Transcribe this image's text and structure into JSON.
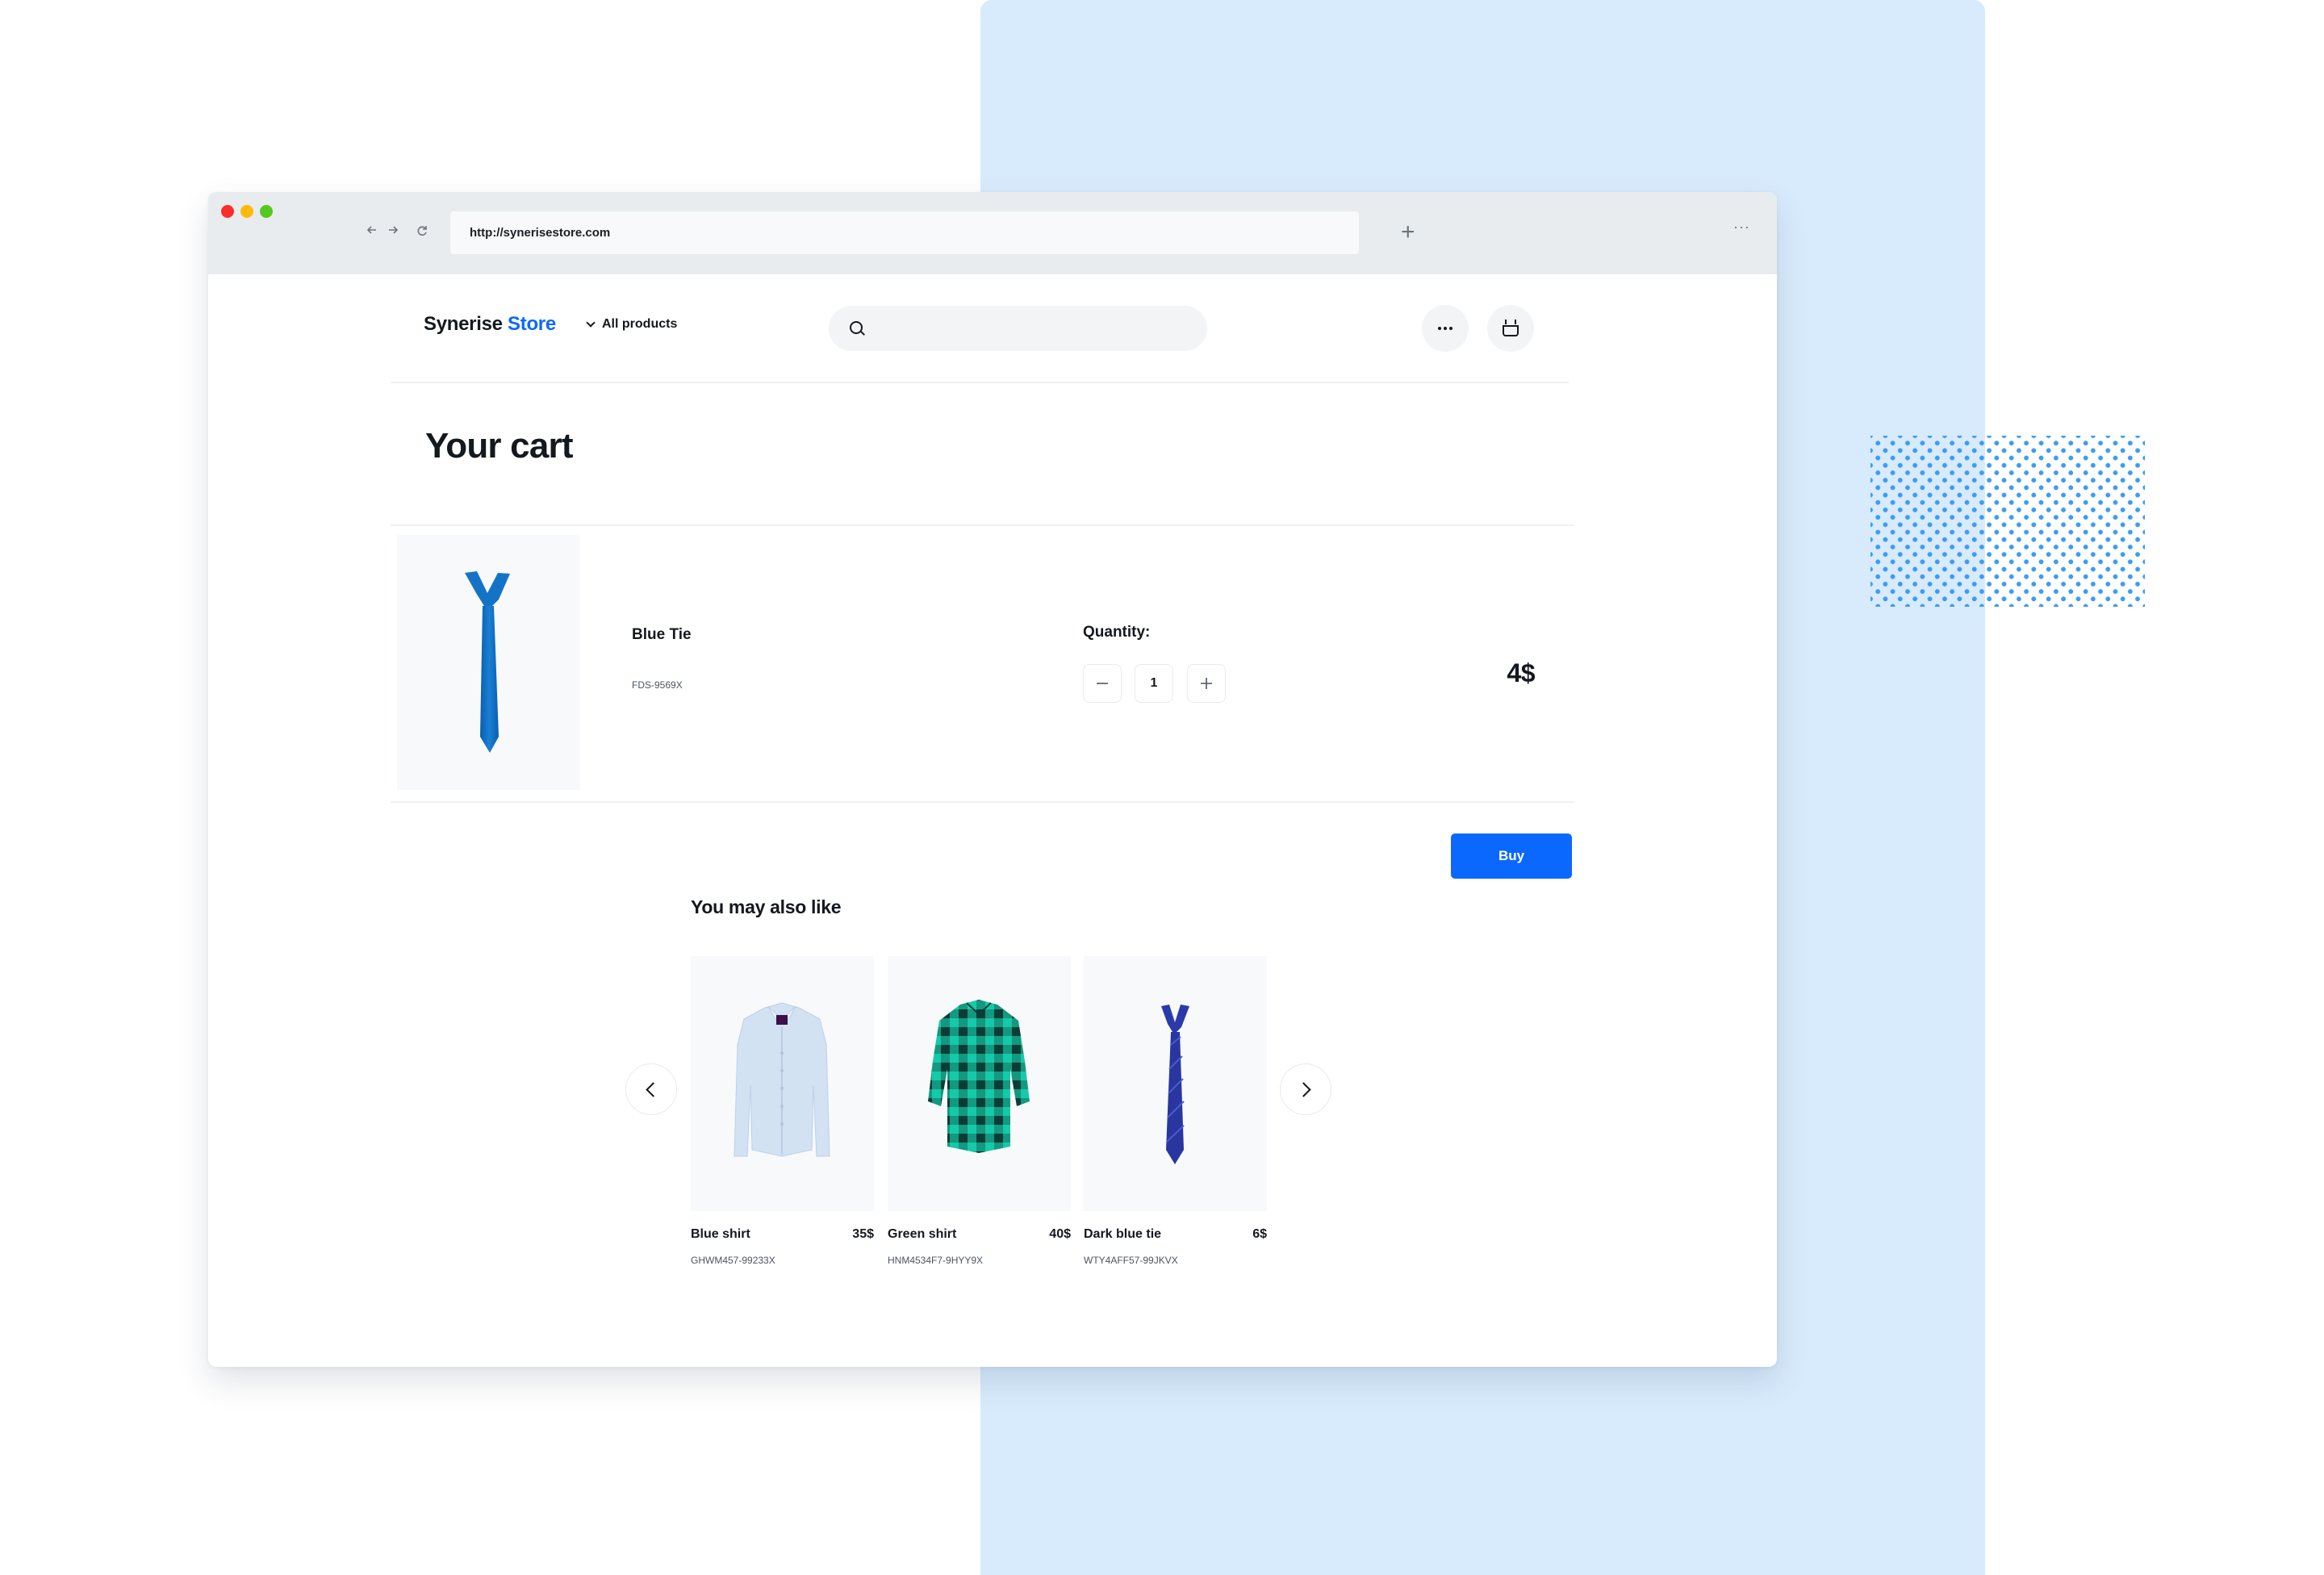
{
  "browser": {
    "url": "http://synerisestore.com",
    "back_icon": "arrow-left",
    "forward_icon": "arrow-right",
    "reload_icon": "reload",
    "new_tab_glyph": "+",
    "menu_glyph": "···"
  },
  "header": {
    "logo_main": "Synerise",
    "logo_accent": "Store",
    "nav_label": "All products",
    "search_placeholder": "",
    "more_icon": "more-horizontal",
    "cart_icon": "basket"
  },
  "cart": {
    "title": "Your cart",
    "items": [
      {
        "name": "Blue Tie",
        "sku": "FDS-9569X",
        "quantity_label": "Quantity:",
        "quantity": "1",
        "price": "4$",
        "image": "blue-tie"
      }
    ],
    "buy_label": "Buy"
  },
  "recommendations": {
    "title": "You may also like",
    "items": [
      {
        "name": "Blue shirt",
        "price": "35$",
        "sku": "GHWM457-99233X",
        "image": "blue-shirt"
      },
      {
        "name": "Green shirt",
        "price": "40$",
        "sku": "HNM4534F7-9HYY9X",
        "image": "green-plaid-shirt"
      },
      {
        "name": "Dark blue tie",
        "price": "6$",
        "sku": "WTY4AFF57-99JKVX",
        "image": "dark-blue-tie"
      }
    ]
  },
  "colors": {
    "brand_blue": "#0b68ff",
    "background_column": "#d8ebfc",
    "chrome_gray": "#e8ecee"
  }
}
